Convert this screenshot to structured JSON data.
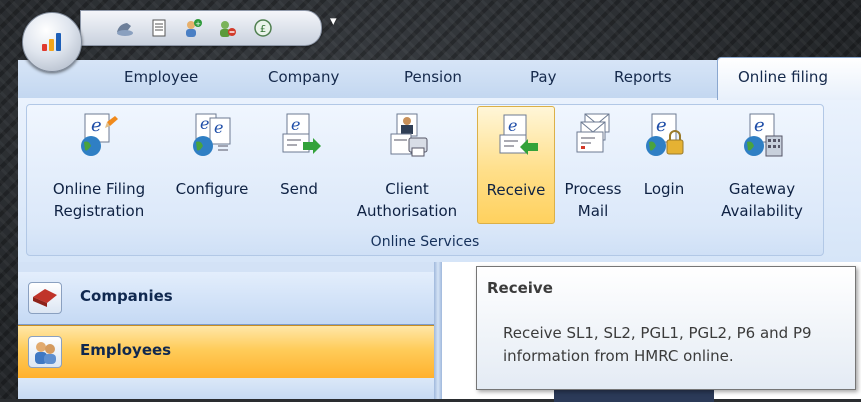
{
  "tabs": [
    {
      "label": "Employee"
    },
    {
      "label": "Company"
    },
    {
      "label": "Pension"
    },
    {
      "label": "Pay"
    },
    {
      "label": "Reports"
    },
    {
      "label": "Online filing"
    }
  ],
  "active_tab": "Online filing",
  "ribbon": {
    "group_label": "Online Services",
    "buttons": [
      {
        "label": "Online Filing\nRegistration",
        "icon": "pencil-globe-icon"
      },
      {
        "label": "Configure",
        "icon": "globe-document-icon"
      },
      {
        "label": "Send",
        "icon": "send-arrow-icon"
      },
      {
        "label": "Client\nAuthorisation",
        "icon": "client-printer-icon"
      },
      {
        "label": "Receive",
        "icon": "receive-arrow-icon",
        "state": "hover"
      },
      {
        "label": "Process\nMail",
        "icon": "mail-stack-icon"
      },
      {
        "label": "Login",
        "icon": "lock-icon"
      },
      {
        "label": "Gateway\nAvailability",
        "icon": "building-globe-icon"
      }
    ]
  },
  "nav": {
    "items": [
      {
        "label": "Companies",
        "icon": "companies-icon"
      },
      {
        "label": "Employees",
        "icon": "employees-icon",
        "selected": true
      }
    ]
  },
  "tooltip": {
    "title": "Receive",
    "body": "Receive SL1, SL2, PGL1, PGL2, P6 and P9 information from HMRC online."
  },
  "qat": {
    "icons": [
      "disk-icon",
      "document-icon",
      "add-user-icon",
      "remove-user-icon",
      "payment-clock-icon"
    ],
    "overflow_glyph": "▾"
  },
  "colors": {
    "hover_fill": "#ffd15e",
    "selected_nav": "#ffcc5a",
    "ribbon_bg": "#dbe8f9"
  }
}
